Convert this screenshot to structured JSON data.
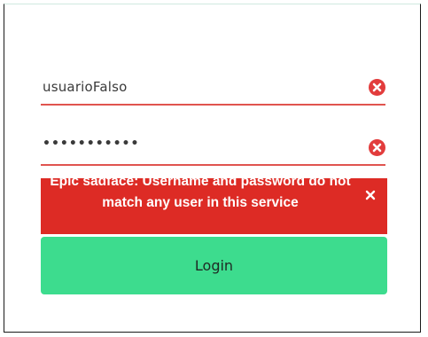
{
  "form": {
    "username_value": "usuarioFalso",
    "password_value": "•••••••••••",
    "username_error_icon": "error-x-circle-icon",
    "password_error_icon": "error-x-circle-icon"
  },
  "alert": {
    "message": "Epic sadface: Username and password do not match any user in this service",
    "close_icon": "close-icon"
  },
  "login_button": {
    "label": "Login"
  },
  "colors": {
    "error_red": "#dd2b25",
    "underline_red": "#e0544f",
    "login_green": "#3ddc8e"
  }
}
